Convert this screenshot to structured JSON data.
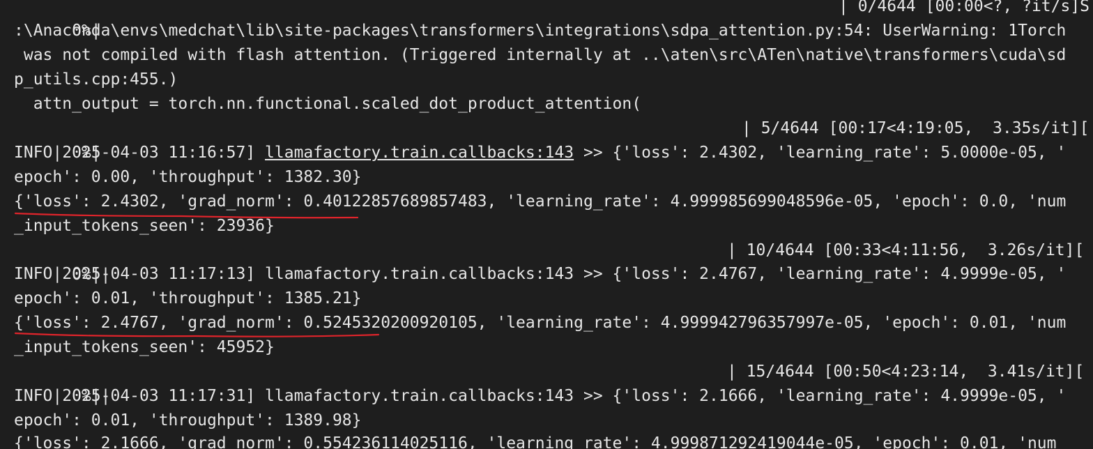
{
  "annotation": {
    "color": "#e0242b"
  },
  "terminal": {
    "rows": [
      {
        "kind": "progress",
        "pct": "  0%|",
        "bar": "",
        "right": "| 0/4644 [00:00<?, ?it/s]S"
      },
      {
        "kind": "text",
        "text": ":\\Anaconda\\envs\\medchat\\lib\\site-packages\\transformers\\integrations\\sdpa_attention.py:54: UserWarning: 1Torch"
      },
      {
        "kind": "text",
        "text": " was not compiled with flash attention. (Triggered internally at ..\\aten\\src\\ATen\\native\\transformers\\cuda\\sd"
      },
      {
        "kind": "text",
        "text": "p_utils.cpp:455.)"
      },
      {
        "kind": "text",
        "text": "  attn_output = torch.nn.functional.scaled_dot_product_attention("
      },
      {
        "kind": "progress",
        "pct": "  0%|",
        "bar": "",
        "right": "| 5/4644 [00:17<4:19:05,  3.35s/it]["
      },
      {
        "kind": "info",
        "prefix": "INFO|2025-04-03 11:16:57] ",
        "link": "llamafactory.train.callbacks:143",
        "suffix": " >> {'loss': 2.4302, 'learning_rate': 5.0000e-05, '"
      },
      {
        "kind": "text",
        "text": "epoch': 0.00, 'throughput': 1382.30}"
      },
      {
        "kind": "text",
        "text": "{'loss': 2.4302, 'grad_norm': 0.40122857689857483, 'learning_rate': 4.999985699048596e-05, 'epoch': 0.0, 'num"
      },
      {
        "kind": "text",
        "text": "_input_tokens_seen': 23936}"
      },
      {
        "kind": "progress",
        "pct": "  0%|",
        "bar": "|",
        "right": "| 10/4644 [00:33<4:11:56,  3.26s/it]["
      },
      {
        "kind": "info",
        "prefix": "INFO|2025-04-03 11:17:13] ",
        "link": "llamafactory.train.callbacks:143",
        "suffix": " >> {'loss': 2.4767, 'learning_rate': 4.9999e-05, '"
      },
      {
        "kind": "text",
        "text": "epoch': 0.01, 'throughput': 1385.21}"
      },
      {
        "kind": "text",
        "text": "{'loss': 2.4767, 'grad_norm': 0.5245320200920105, 'learning_rate': 4.999942796357997e-05, 'epoch': 0.01, 'num"
      },
      {
        "kind": "text",
        "text": "_input_tokens_seen': 45952}"
      },
      {
        "kind": "progress",
        "pct": "  0%|",
        "bar": "|",
        "right": "| 15/4644 [00:50<4:23:14,  3.41s/it]["
      },
      {
        "kind": "info",
        "prefix": "INFO|2025-04-03 11:17:31] ",
        "link": "llamafactory.train.callbacks:143",
        "suffix": " >> {'loss': 2.1666, 'learning_rate': 4.9999e-05, '"
      },
      {
        "kind": "text",
        "text": "epoch': 0.01, 'throughput': 1389.98}"
      },
      {
        "kind": "text",
        "text": "{'loss': 2.1666, 'grad_norm': 0.554236114025116, 'learning_rate': 4.999871292419044e-05, 'epoch': 0.01, 'num"
      }
    ]
  }
}
